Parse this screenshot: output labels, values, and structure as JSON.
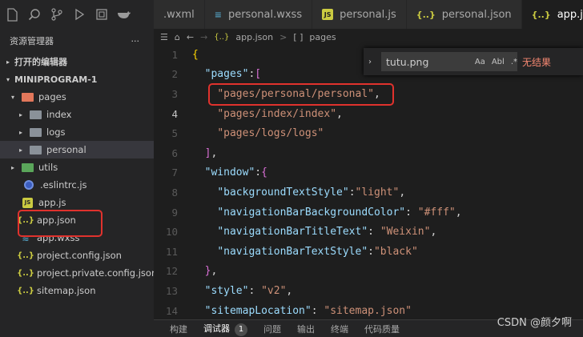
{
  "activity_bar": {
    "icons": [
      "files-icon",
      "search-icon",
      "source-control-icon",
      "debug-icon",
      "extensions-icon",
      "docker-icon"
    ]
  },
  "tabs": [
    {
      "label": ".wxml",
      "icon": "",
      "active": false
    },
    {
      "label": "personal.wxss",
      "icon": "css-icon",
      "active": false
    },
    {
      "label": "personal.js",
      "icon": "js-icon",
      "active": false
    },
    {
      "label": "personal.json",
      "icon": "json-icon",
      "active": false
    },
    {
      "label": "app.json",
      "icon": "json-icon",
      "active": true
    }
  ],
  "sidebar": {
    "title": "资源管理器",
    "more": "···",
    "open_editors": "打开的编辑器",
    "project": "MINIPROGRAM-1",
    "tree": [
      {
        "label": "pages",
        "type": "folder-orange",
        "depth": 1,
        "chevron": "▾"
      },
      {
        "label": "index",
        "type": "folder",
        "depth": 2,
        "chevron": "▸"
      },
      {
        "label": "logs",
        "type": "folder",
        "depth": 2,
        "chevron": "▸"
      },
      {
        "label": "personal",
        "type": "folder",
        "depth": 2,
        "chevron": "▸",
        "selected": true
      },
      {
        "label": "utils",
        "type": "folder-green",
        "depth": 1,
        "chevron": "▸"
      },
      {
        "label": ".eslintrc.js",
        "type": "eslint",
        "depth": 1
      },
      {
        "label": "app.js",
        "type": "js",
        "depth": 1
      },
      {
        "label": "app.json",
        "type": "json",
        "depth": 1
      },
      {
        "label": "app.wxss",
        "type": "wxss",
        "depth": 1
      },
      {
        "label": "project.config.json",
        "type": "json",
        "depth": 1
      },
      {
        "label": "project.private.config.json",
        "type": "json",
        "depth": 1
      },
      {
        "label": "sitemap.json",
        "type": "json",
        "depth": 1
      }
    ]
  },
  "breadcrumb": {
    "file": "app.json",
    "sep": ">",
    "brackets": "[ ]",
    "node": "pages"
  },
  "find": {
    "value": "tutu.png",
    "match_case": "Aa",
    "whole_word": "Abl",
    "regex": ".*",
    "result": "无结果"
  },
  "code": {
    "line_numbers": [
      "1",
      "2",
      "3",
      "4",
      "5",
      "6",
      "7",
      "8",
      "9",
      "10",
      "11",
      "12",
      "13",
      "14"
    ],
    "current_line": "4",
    "lines": [
      [
        {
          "t": "{",
          "c": "b1"
        }
      ],
      [
        {
          "t": "  "
        },
        {
          "t": "\"pages\"",
          "c": "key"
        },
        {
          "t": ":",
          "c": "p"
        },
        {
          "t": "[",
          "c": "b2"
        }
      ],
      [
        {
          "t": "    "
        },
        {
          "t": "\"pages/personal/personal\"",
          "c": "str"
        },
        {
          "t": ",",
          "c": "p"
        }
      ],
      [
        {
          "t": "    "
        },
        {
          "t": "\"pages/index/index\"",
          "c": "str"
        },
        {
          "t": ",",
          "c": "p"
        }
      ],
      [
        {
          "t": "    "
        },
        {
          "t": "\"pages/logs/logs\"",
          "c": "str"
        }
      ],
      [
        {
          "t": "  "
        },
        {
          "t": "]",
          "c": "b2"
        },
        {
          "t": ",",
          "c": "p"
        }
      ],
      [
        {
          "t": "  "
        },
        {
          "t": "\"window\"",
          "c": "key"
        },
        {
          "t": ":",
          "c": "p"
        },
        {
          "t": "{",
          "c": "b2"
        }
      ],
      [
        {
          "t": "    "
        },
        {
          "t": "\"backgroundTextStyle\"",
          "c": "key"
        },
        {
          "t": ":",
          "c": "p"
        },
        {
          "t": "\"light\"",
          "c": "str"
        },
        {
          "t": ",",
          "c": "p"
        }
      ],
      [
        {
          "t": "    "
        },
        {
          "t": "\"navigationBarBackgroundColor\"",
          "c": "key"
        },
        {
          "t": ": ",
          "c": "p"
        },
        {
          "t": "\"#fff\"",
          "c": "str"
        },
        {
          "t": ",",
          "c": "p"
        }
      ],
      [
        {
          "t": "    "
        },
        {
          "t": "\"navigationBarTitleText\"",
          "c": "key"
        },
        {
          "t": ": ",
          "c": "p"
        },
        {
          "t": "\"Weixin\"",
          "c": "str"
        },
        {
          "t": ",",
          "c": "p"
        }
      ],
      [
        {
          "t": "    "
        },
        {
          "t": "\"navigationBarTextStyle\"",
          "c": "key"
        },
        {
          "t": ":",
          "c": "p"
        },
        {
          "t": "\"black\"",
          "c": "str"
        }
      ],
      [
        {
          "t": "  "
        },
        {
          "t": "}",
          "c": "b2"
        },
        {
          "t": ",",
          "c": "p"
        }
      ],
      [
        {
          "t": "  "
        },
        {
          "t": "\"style\"",
          "c": "key"
        },
        {
          "t": ": ",
          "c": "p"
        },
        {
          "t": "\"v2\"",
          "c": "str"
        },
        {
          "t": ",",
          "c": "p"
        }
      ],
      [
        {
          "t": "  "
        },
        {
          "t": "\"sitemapLocation\"",
          "c": "key"
        },
        {
          "t": ": ",
          "c": "p"
        },
        {
          "t": "\"sitemap.json\"",
          "c": "str"
        }
      ]
    ]
  },
  "panel": {
    "tabs": [
      "构建",
      "调试器",
      "问题",
      "输出",
      "终端",
      "代码质量"
    ],
    "active": "调试器",
    "debugger_badge": "1"
  },
  "watermark": "CSDN @颜夕啊",
  "colors": {
    "highlight": "#e0322d",
    "json_icon": "#cbcb41",
    "css_icon": "#519aba"
  }
}
